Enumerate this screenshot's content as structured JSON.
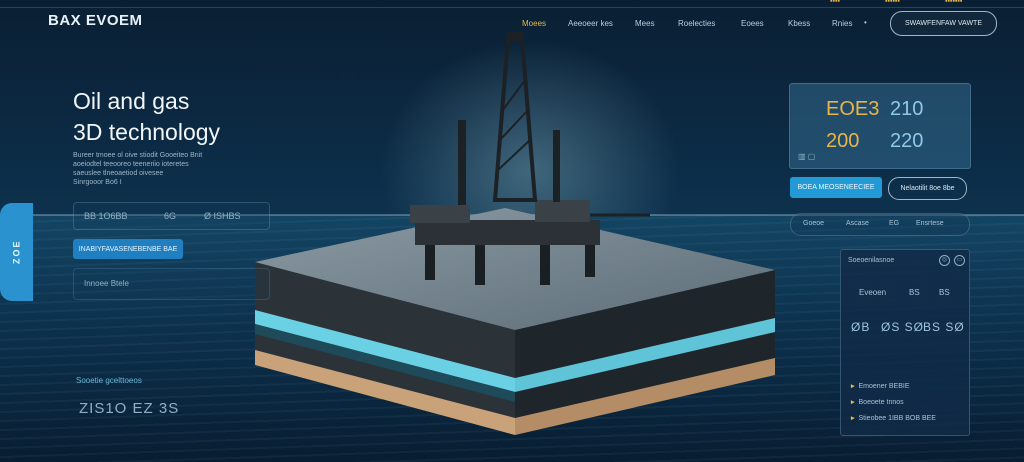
{
  "top_strip": [
    "▪▪▪▪",
    "▪▪▪▪▪▪",
    "▪▪▪▪▪▪▪"
  ],
  "logo": "BAX EVOEM",
  "nav": {
    "items": [
      "Moees",
      "Aeeoeer kes",
      "Mees",
      "Roelecties",
      "Eoees",
      "Kbess",
      "Rnies"
    ],
    "more": "•",
    "cta": "SWAWFENFAW VAWTE"
  },
  "hero": {
    "title_line1": "Oil and gas",
    "title_line2": "3D technology",
    "desc_line1": "Bureer tmoee ol oive stiodit Gooeiteo Bnit",
    "desc_line2": "aoeiodtel teeooreo teeneriio ioteretes",
    "desc_line3": "saeuslee tlneoaetiod oivesee",
    "desc_line4": "Sinrgooor Bo6 I",
    "field_a": "BB 1O6BB",
    "field_b": "6G",
    "field_c": "Ø ISHBS",
    "button": "INABIYFAVASENEBENBE BAE",
    "field2": "Innoee Btele",
    "stat_label": "Sooetie gcelttoeos",
    "stat_value": "ZIS1O EZ 3S"
  },
  "side_tab": "ZOE",
  "birds": "⌄ ⌄⌄ ⌄ ⌄",
  "readout": {
    "row1_a": "EOE3",
    "row1_b": "210",
    "row2_a": "200",
    "row2_b": "220",
    "icon": "▥ ▢"
  },
  "actions": {
    "primary": "BOEA MEOSENEECIEE",
    "secondary": "Nelaotilit 8oe 8be"
  },
  "filters": [
    "Goeoe",
    "Ascase",
    "EG",
    "Ensrtese"
  ],
  "panel": {
    "title": "Soeoenilasnoe",
    "icons": [
      "◎",
      "▭"
    ],
    "row_labels": [
      "Eveoen",
      "BS",
      "BS"
    ],
    "values": [
      "ØB",
      "ØS SØ",
      "BS SØ"
    ],
    "lines": [
      {
        "bullet": "▸",
        "text": "Emoener BEBIE"
      },
      {
        "bullet": "▸",
        "text": "Boeoete tnnos"
      },
      {
        "bullet": "▸",
        "text": "Stieobee 1IBB BOB BEE"
      }
    ]
  },
  "colors": {
    "accent_gold": "#e3b64a",
    "accent_blue": "#229ad6",
    "bg": "#0c2a44"
  }
}
